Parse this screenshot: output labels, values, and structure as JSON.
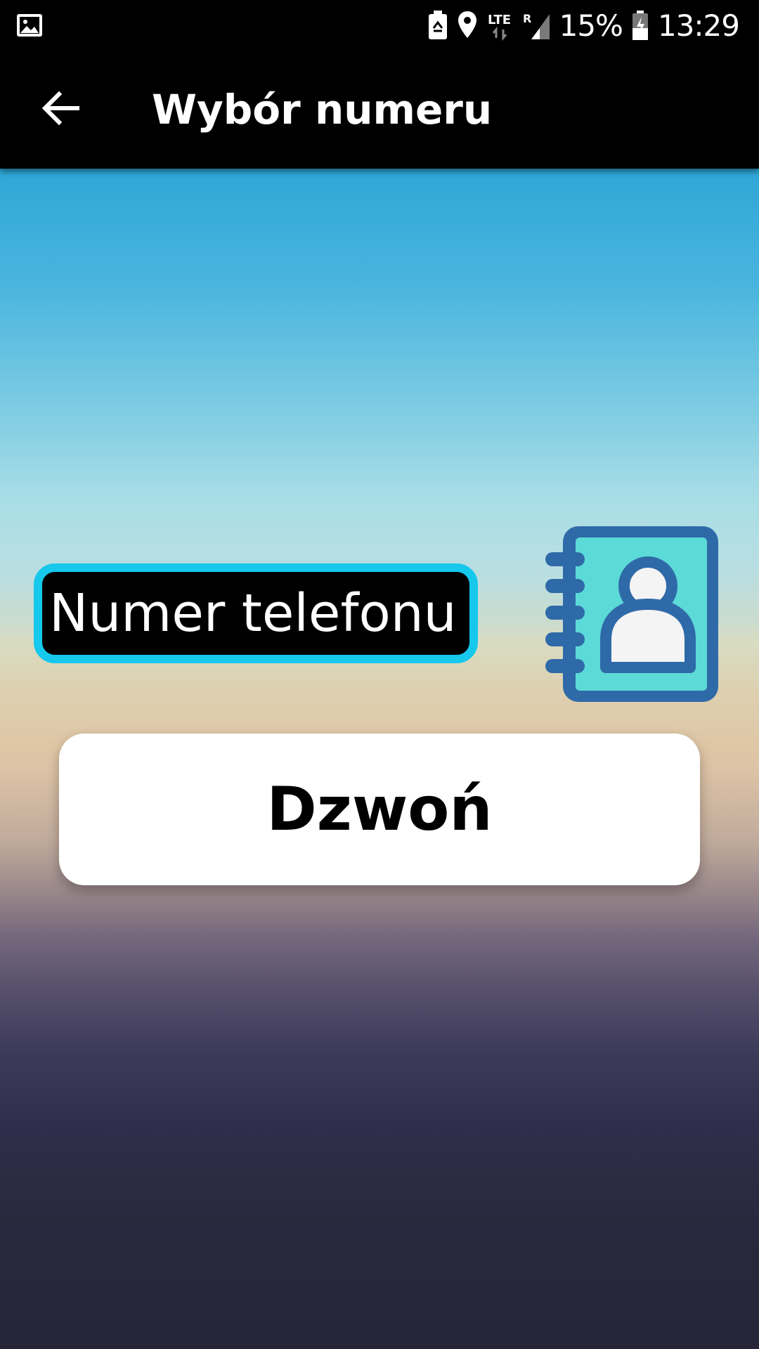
{
  "status_bar": {
    "battery_percent": "15%",
    "time": "13:29",
    "network_label": "LTE",
    "roaming_label": "R",
    "icons": [
      "gallery-icon",
      "battery-saver-icon",
      "location-icon",
      "lte-icon",
      "signal-icon",
      "battery-charging-icon"
    ]
  },
  "app_bar": {
    "title": "Wybór numeru",
    "back_icon": "arrow-left-icon"
  },
  "phone_input": {
    "value": "",
    "placeholder": "Numer telefonu"
  },
  "contacts_icon": "address-book-icon",
  "call_button": {
    "label": "Dzwoń"
  },
  "colors": {
    "input_border": "#15c8ec",
    "book_outline": "#2f6aa8",
    "book_fill": "#5cdad8",
    "person_fill": "#f4f4f4"
  }
}
